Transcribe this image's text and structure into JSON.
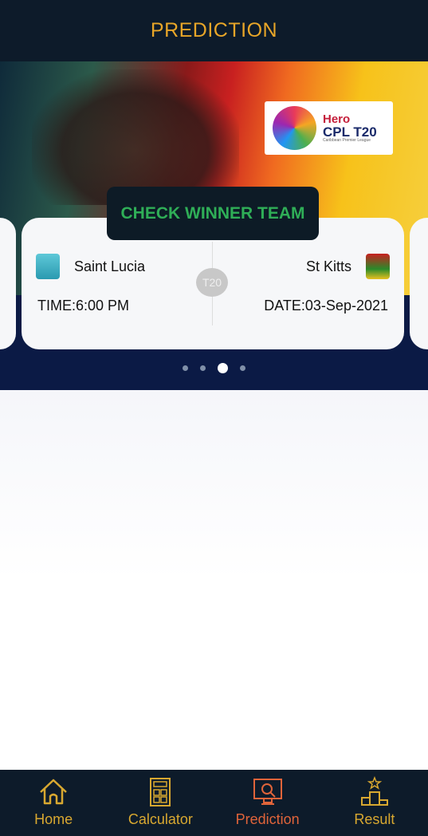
{
  "header": {
    "title": "PREDICTION"
  },
  "banner": {
    "sponsor": "Hero",
    "league": "CPL T20",
    "league_full": "Caribbean Premier League"
  },
  "cta": {
    "label": "CHECK WINNER TEAM"
  },
  "match": {
    "team_home": "Saint Lucia",
    "team_away": "St Kitts",
    "format": "T20",
    "time": "TIME:6:00 PM",
    "date": "DATE:03-Sep-2021"
  },
  "carousel": {
    "total_pages": 4,
    "active_page": 3
  },
  "colors": {
    "accent": "#e8a628",
    "active_nav": "#e0643a",
    "cta_text": "#2fae57",
    "header_bg": "#0d1b2a"
  },
  "nav": [
    {
      "label": "Home",
      "icon": "home-icon"
    },
    {
      "label": "Calculator",
      "icon": "calculator-icon"
    },
    {
      "label": "Prediction",
      "icon": "monitor-analysis-icon",
      "active": true
    },
    {
      "label": "Result",
      "icon": "podium-icon"
    }
  ]
}
